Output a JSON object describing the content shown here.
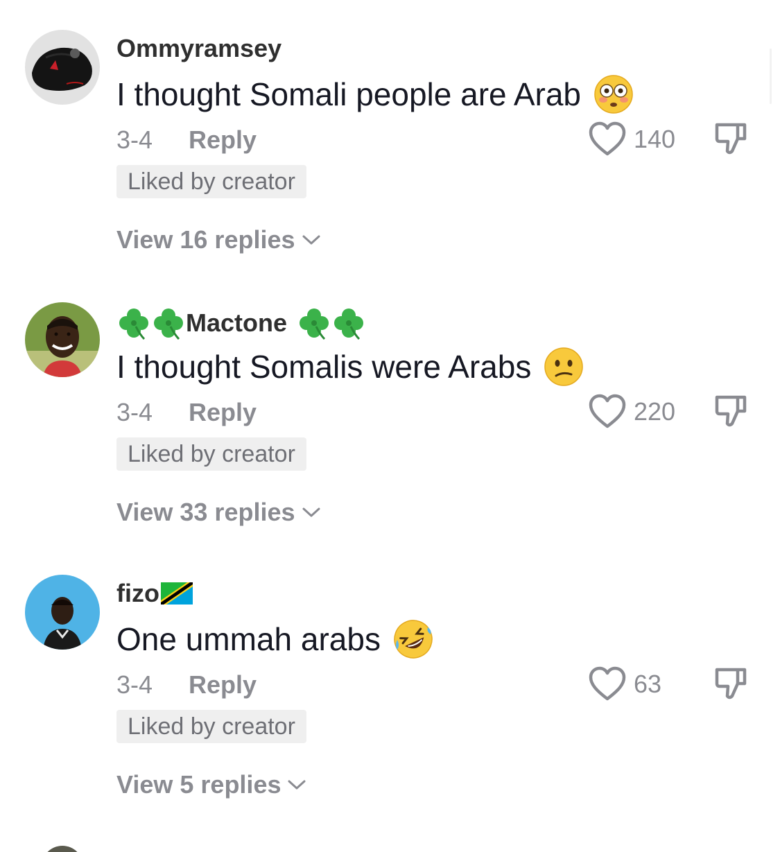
{
  "colors": {
    "text_primary": "#161823",
    "text_secondary": "#8a8b91",
    "badge_bg": "#efefef",
    "icon_gray": "#8a8b91"
  },
  "comments": [
    {
      "username": "Ommyramsey",
      "text": "I thought Somali people are Arab",
      "emoji": "flushed-face",
      "date": "3-4",
      "reply_label": "Reply",
      "likes": "140",
      "badge": "Liked by creator",
      "view_replies": "View 16 replies"
    },
    {
      "username": "Mactone",
      "username_decoration": "four-leaf-clover",
      "text": "I thought Somalis were Arabs",
      "emoji": "confused-face",
      "date": "3-4",
      "reply_label": "Reply",
      "likes": "220",
      "badge": "Liked by creator",
      "view_replies": "View 33 replies"
    },
    {
      "username": "fizo",
      "username_decoration": "tanzania-flag",
      "text": "One ummah arabs",
      "emoji": "rolling-on-floor-laughing-face",
      "date": "3-4",
      "reply_label": "Reply",
      "likes": "63",
      "badge": "Liked by creator",
      "view_replies": "View 5 replies"
    }
  ]
}
